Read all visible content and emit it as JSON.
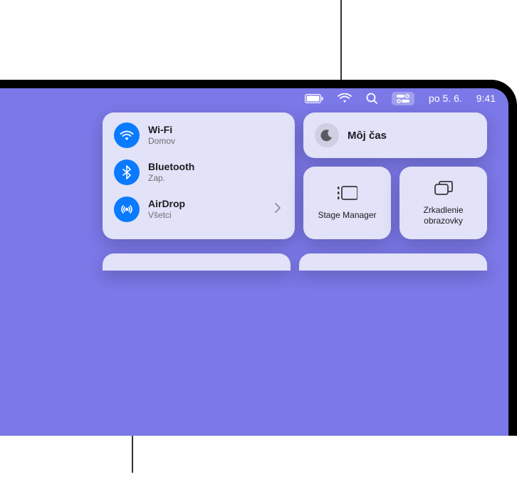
{
  "menubar": {
    "date": "po 5. 6.",
    "time": "9:41"
  },
  "controlCenter": {
    "connectivity": {
      "wifi": {
        "title": "Wi-Fi",
        "subtitle": "Domov"
      },
      "bluetooth": {
        "title": "Bluetooth",
        "subtitle": "Zap."
      },
      "airdrop": {
        "title": "AirDrop",
        "subtitle": "Všetci"
      }
    },
    "focus": {
      "label": "Môj čas"
    },
    "stageManager": {
      "label": "Stage Manager"
    },
    "screenMirroring": {
      "label": "Zrkadlenie obrazovky"
    }
  }
}
